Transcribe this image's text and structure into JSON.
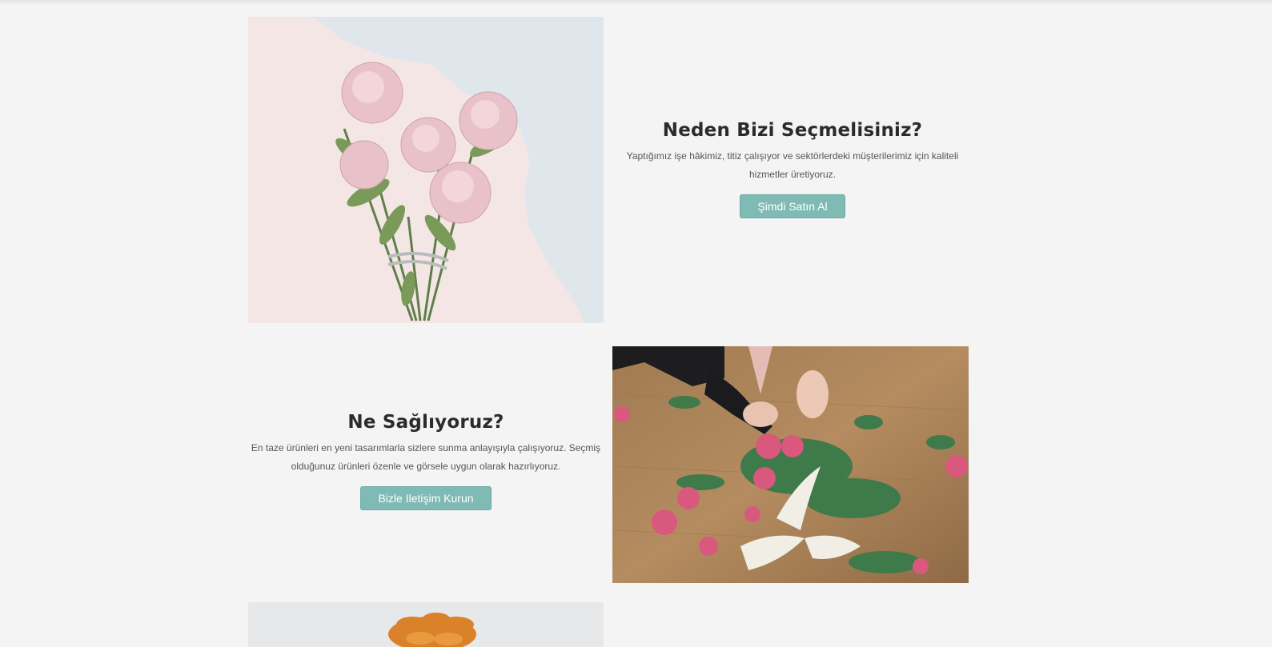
{
  "sections": [
    {
      "title": "Neden Bizi Seçmelisiniz?",
      "description": "Yaptığımız işe hâkimiz, titiz çalışıyor ve sektörlerdeki müşterilerimiz için kaliteli hizmetler üretiyoruz.",
      "button_label": "Şimdi Satın Al",
      "image": "pink-peony-bouquet-photo"
    },
    {
      "title": "Ne Sağlıyoruz?",
      "description": "En taze ürünleri en yeni tasarımlarla sizlere sunma anlayışıyla çalışıyoruz. Seçmiş olduğunuz ürünleri özenle ve görsele uygun olarak hazırlıyoruz.",
      "button_label": "Bizle Iletişim Kurun",
      "image": "florist-arranging-roses-photo"
    },
    {
      "image": "orange-flowers-photo"
    }
  ],
  "colors": {
    "background": "#f4f4f4",
    "button": "#7fbab5",
    "heading": "#2b2b2b"
  }
}
